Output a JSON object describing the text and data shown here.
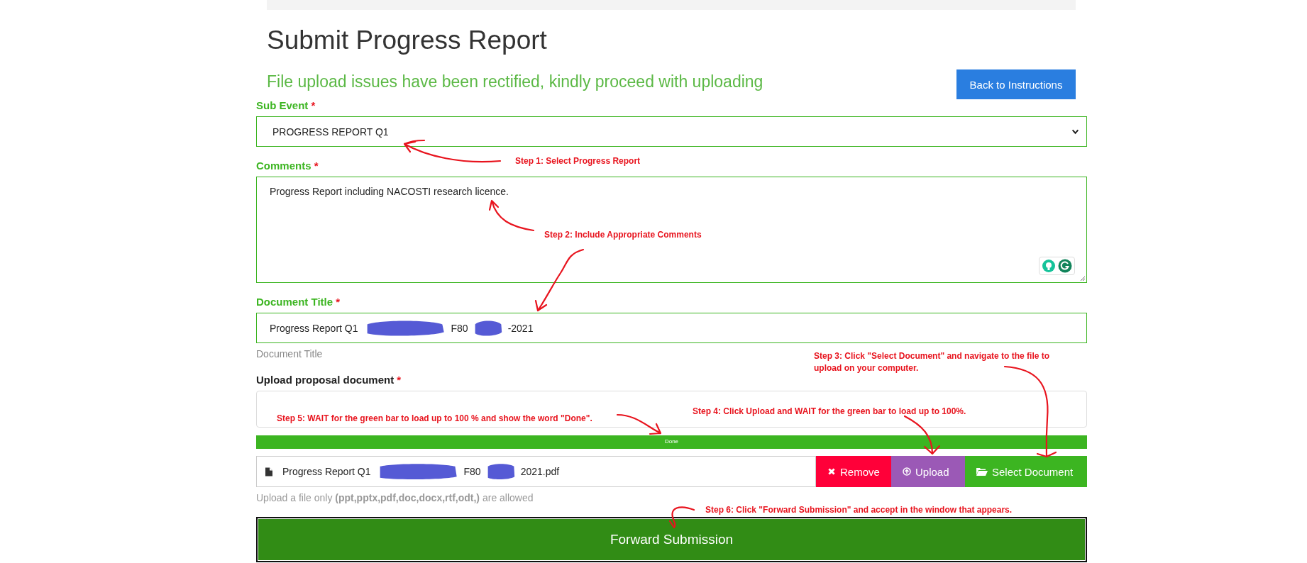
{
  "header": {
    "title": "Submit Progress Report",
    "notice": "File upload issues have been rectified, kindly proceed with uploading",
    "back_button": "Back to Instructions"
  },
  "fields": [
    {
      "kind": "select",
      "label": "Sub Event",
      "required_mark": "*",
      "value": "PROGRESS REPORT Q1"
    },
    {
      "kind": "textarea",
      "label": "Comments",
      "required_mark": "*",
      "value": "Progress Report including NACOSTI research licence."
    },
    {
      "kind": "text",
      "label": "Document Title",
      "required_mark": "*",
      "value_parts": [
        "Progress Report Q1",
        "F80",
        "-2021"
      ],
      "help": "Document Title"
    }
  ],
  "upload": {
    "label": "Upload proposal document",
    "required_mark": "*",
    "progress": {
      "level": 1,
      "label": "Done"
    },
    "file_parts": [
      "Progress Report Q1",
      "F80",
      "2021.pdf"
    ],
    "buttons": [
      {
        "kind": "remove",
        "label": "Remove"
      },
      {
        "kind": "upload",
        "label": "Upload"
      },
      {
        "kind": "browse",
        "label": "Select Document"
      }
    ],
    "hint": "Upload a file only **(ppt,pptx,pdf,doc,docx,rtf,odt,)** are allowed"
  },
  "submit_button": "Forward Submission",
  "annotations": [
    "Step 1: Select Progress Report",
    "Step 2: Include Appropriate Comments",
    "Step 3: Click \"Select Document\" and navigate to the file to upload on your computer.",
    "Step 4: Click Upload and WAIT for the green bar to load up to 100%.",
    "Step 5: WAIT for the green bar to load up to 100 % and show the word \"Done\".",
    "Step 6: Click \"Forward Submission\" and accept in the window that appears."
  ]
}
